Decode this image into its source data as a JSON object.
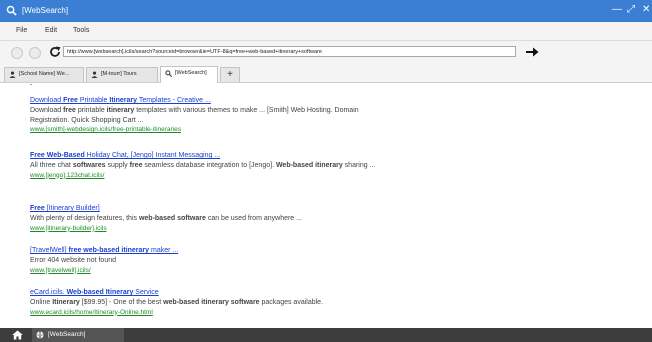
{
  "window": {
    "title": "[WebSearch]",
    "controls": [
      "minimize-icon",
      "maximize-icon",
      "close-icon"
    ],
    "accent": "#3b7fd4"
  },
  "menu": [
    "File",
    "Edit",
    "Tools"
  ],
  "nav": {
    "url": "http://www.[websearch].icils/search?sourceid=browser&ie=UTF-8&q=free+web-based+itinerary+software"
  },
  "tabs": [
    {
      "label": "[School Name] We...",
      "icon": "person-icon"
    },
    {
      "label": "[M-tourr] Tours",
      "icon": "person-icon"
    },
    {
      "label": "[WebSearch]",
      "icon": "search-icon",
      "active": true
    }
  ],
  "new_tab_label": "+",
  "results": [
    {
      "title": [
        {
          "t": "Download "
        },
        {
          "t": "Free",
          "b": true
        },
        {
          "t": " Printable "
        },
        {
          "t": "Itinerary",
          "b": true
        },
        {
          "t": " Templates - Creative ..."
        }
      ],
      "desc": [
        {
          "t": "Download "
        },
        {
          "t": "free",
          "b": true
        },
        {
          "t": " printable "
        },
        {
          "t": "itinerary",
          "b": true
        },
        {
          "t": " templates with various themes to make ... [Smith] Web Hosting. Domain Registration. Quick Shopping Cart ..."
        }
      ],
      "url": "www.[smith]-webdesign.icils/free-printable-itineraries"
    },
    {
      "title": [
        {
          "t": "Free Web-Based",
          "b": true
        },
        {
          "t": " Holiday Chat, [Jengo] Instant Messaging ..."
        }
      ],
      "desc": [
        {
          "t": "All three chat "
        },
        {
          "t": "softwares",
          "b": true
        },
        {
          "t": " supply "
        },
        {
          "t": "free",
          "b": true
        },
        {
          "t": " seamless database integration to [Jengo]. "
        },
        {
          "t": "Web-based itinerary",
          "b": true
        },
        {
          "t": " sharing ..."
        }
      ],
      "url": "www.[jengo].123chat.icils/"
    },
    {
      "title": [
        {
          "t": "Free",
          "b": true
        },
        {
          "t": " [Itinerary Builder]"
        }
      ],
      "desc": [
        {
          "t": "With plenty of design features, this "
        },
        {
          "t": "web-based software",
          "b": true
        },
        {
          "t": " can be used from anywhere ..."
        }
      ],
      "url": "www.[itinerary-builder].icils"
    },
    {
      "title": [
        {
          "t": "[TravelWell] "
        },
        {
          "t": "free web-based itinerary",
          "b": true
        },
        {
          "t": " maker ..."
        }
      ],
      "desc": [
        {
          "t": "Error 404 website not found"
        }
      ],
      "url": "www.[travelwell].icils/"
    },
    {
      "title": [
        {
          "t": "eCard.icils. "
        },
        {
          "t": "Web-based Itinerary",
          "b": true
        },
        {
          "t": " Service"
        }
      ],
      "desc": [
        {
          "t": "Online "
        },
        {
          "t": "Itinerary",
          "b": true
        },
        {
          "t": " [$99.95] - One of the best "
        },
        {
          "t": "web-based itinerary software",
          "b": true
        },
        {
          "t": " packages available."
        }
      ],
      "url": "www.ecard.icils/home/Itinerary-Online.html"
    }
  ],
  "taskbar": {
    "items": [
      {
        "label": "[WebSearch]",
        "icon": "globe-icon"
      }
    ]
  }
}
